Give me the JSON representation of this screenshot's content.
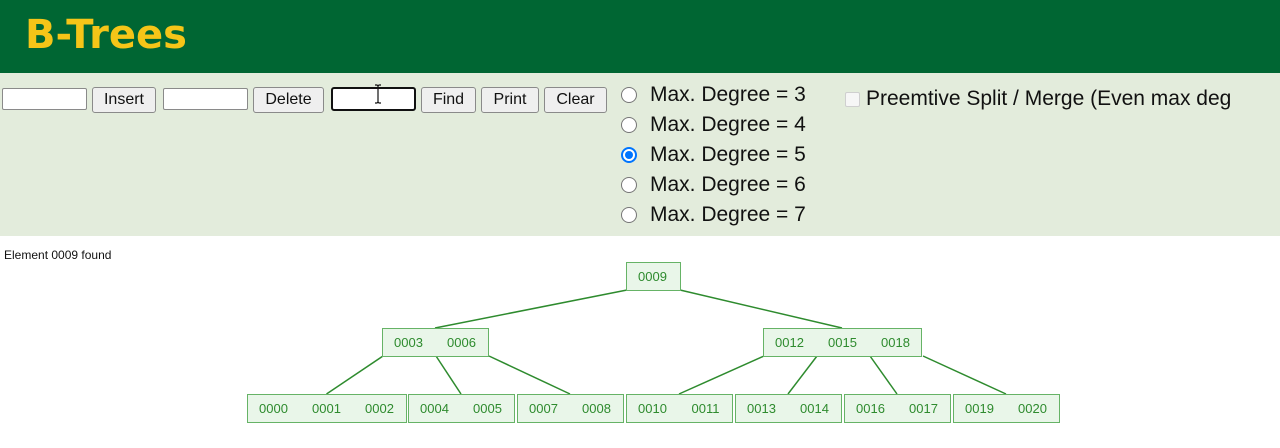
{
  "header": {
    "title": "B-Trees"
  },
  "controls": {
    "insert_input": {
      "value": "",
      "placeholder": ""
    },
    "insert_label": "Insert",
    "delete_input": {
      "value": "",
      "placeholder": ""
    },
    "delete_label": "Delete",
    "find_input": {
      "value": "",
      "placeholder": ""
    },
    "find_label": "Find",
    "print_label": "Print",
    "clear_label": "Clear"
  },
  "degree_options": [
    {
      "label": "Max. Degree = 3",
      "checked": false
    },
    {
      "label": "Max. Degree = 4",
      "checked": false
    },
    {
      "label": "Max. Degree = 5",
      "checked": true
    },
    {
      "label": "Max. Degree = 6",
      "checked": false
    },
    {
      "label": "Max. Degree = 7",
      "checked": false
    }
  ],
  "preemptive": {
    "label": "Preemtive Split / Merge (Even max deg",
    "checked": false,
    "enabled": false
  },
  "status": "Element 0009 found",
  "tree": {
    "nodes": [
      {
        "id": "root",
        "keys": [
          "0009"
        ]
      },
      {
        "id": "n1",
        "keys": [
          "0003",
          "0006"
        ]
      },
      {
        "id": "n2",
        "keys": [
          "0012",
          "0015",
          "0018"
        ]
      },
      {
        "id": "l1",
        "keys": [
          "0000",
          "0001",
          "0002"
        ]
      },
      {
        "id": "l2",
        "keys": [
          "0004",
          "0005"
        ]
      },
      {
        "id": "l3",
        "keys": [
          "0007",
          "0008"
        ]
      },
      {
        "id": "l4",
        "keys": [
          "0010",
          "0011"
        ]
      },
      {
        "id": "l5",
        "keys": [
          "0013",
          "0014"
        ]
      },
      {
        "id": "l6",
        "keys": [
          "0016",
          "0017"
        ]
      },
      {
        "id": "l7",
        "keys": [
          "0019",
          "0020"
        ]
      }
    ],
    "edges": [
      [
        "root",
        "n1"
      ],
      [
        "root",
        "n2"
      ],
      [
        "n1",
        "l1"
      ],
      [
        "n1",
        "l2"
      ],
      [
        "n1",
        "l3"
      ],
      [
        "n2",
        "l4"
      ],
      [
        "n2",
        "l5"
      ],
      [
        "n2",
        "l6"
      ],
      [
        "n2",
        "l7"
      ]
    ],
    "colors": {
      "node_fill": "#e9f6e9",
      "node_stroke": "#66b366",
      "text": "#2e8b2e",
      "edge": "#2e8b2e"
    }
  },
  "colors": {
    "header_bg": "#006633",
    "title": "#f5c518",
    "toolbar_bg": "#e3ecdc",
    "radio_accent": "#0075ff"
  }
}
